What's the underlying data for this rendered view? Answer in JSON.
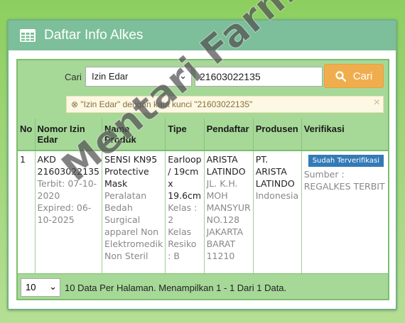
{
  "header": {
    "title": "Daftar Info Alkes",
    "icon": "table-icon"
  },
  "search": {
    "label": "Cari",
    "field_selected": "Izin Edar",
    "keyword_value": "21603022135",
    "button_label": "Cari",
    "button_color": "#f0ad4e"
  },
  "alert": {
    "text": "\"Izin Edar\" dengan kata kunci \"21603022135\""
  },
  "table": {
    "headers": [
      "No",
      "Nomor Izin Edar",
      "Nama Produk",
      "Tipe",
      "Pendaftar",
      "Produsen",
      "Verifikasi"
    ],
    "row": {
      "no": "1",
      "nomor_izin": "AKD 21603022135",
      "terbit": "Terbit: 07-10-2020",
      "expired": "Expired: 06-10-2025",
      "nama_produk": "SENSI KN95 Protective Mask",
      "kategori": "Peralatan Bedah Surgical apparel Non Elektromedik Non Steril",
      "tipe": "Earloop / 19cm x 19.6cm",
      "kelas": "Kelas : 2",
      "kelas_resiko": "Kelas Resiko : B",
      "pendaftar_nama": "ARISTA LATINDO",
      "pendaftar_alamat": "JL. K.H. MOH MANSYUR NO.128 JAKARTA BARAT 11210",
      "produsen_nama": "PT. ARISTA LATINDO",
      "produsen_negara": "Indonesia",
      "verifikasi_badge": "Sudah Terverifikasi",
      "sumber": "Sumber : REGALKES TERBIT"
    }
  },
  "footer": {
    "per_page": "10",
    "text": "10 Data Per Halaman. Menampilkan 1 - 1 Dari 1 Data."
  },
  "watermark": "Mentari Farma"
}
